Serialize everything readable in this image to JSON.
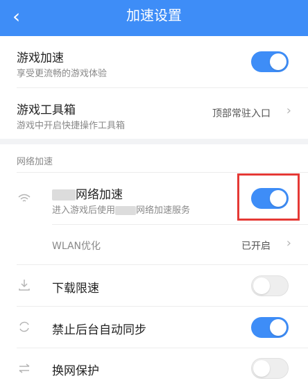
{
  "header": {
    "title": "加速设置",
    "back_glyph": "‹"
  },
  "game_accel": {
    "title": "游戏加速",
    "subtitle": "享受更流畅的游戏体验",
    "enabled": true
  },
  "game_toolbox": {
    "title": "游戏工具箱",
    "subtitle": "游戏中开启快捷操作工具箱",
    "value": "顶部常驻入口"
  },
  "network": {
    "section_label": "网络加速",
    "accel": {
      "title": "网络加速",
      "subtitle_prefix": "进入游戏后使用",
      "subtitle_suffix": "网络加速服务",
      "enabled": true,
      "icon": "wifi-icon"
    },
    "wlan": {
      "title": "WLAN优化",
      "value": "已开启"
    },
    "download_limit": {
      "title": "下载限速",
      "enabled": false,
      "icon": "download-icon"
    },
    "no_bg_sync": {
      "title": "禁止后台自动同步",
      "enabled": true,
      "icon": "sync-icon"
    },
    "net_switch": {
      "title": "换网保护",
      "enabled": false,
      "icon": "swap-icon"
    }
  },
  "colors": {
    "accent": "#3e8df7",
    "highlight": "#e53935"
  }
}
